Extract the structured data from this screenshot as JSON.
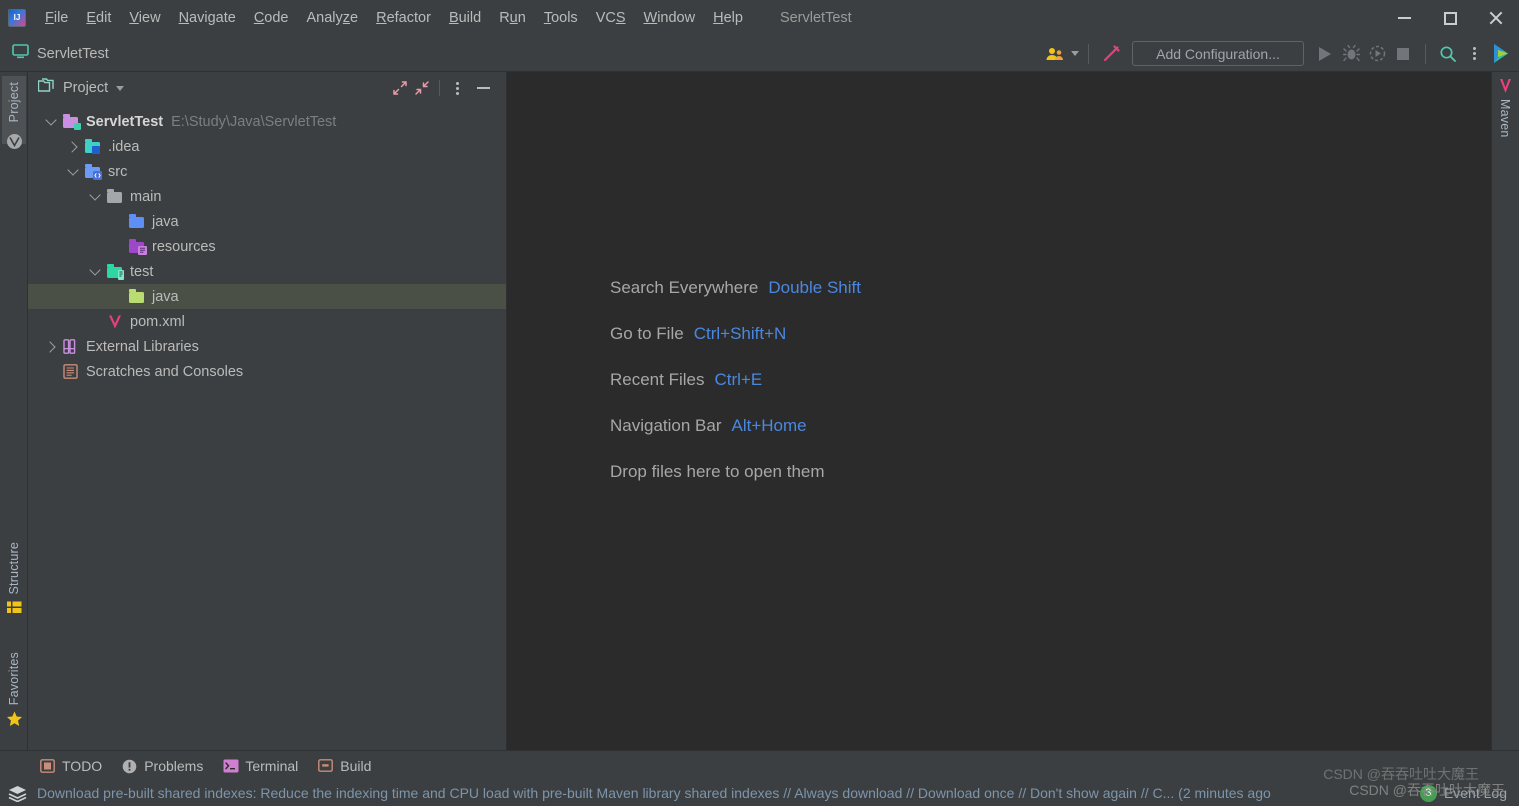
{
  "window": {
    "title": "ServletTest",
    "app_icon": "intellij-idea-logo",
    "minimize": "minimize-window",
    "maximize": "maximize-window",
    "close": "close-window"
  },
  "menubar": {
    "items": [
      {
        "label": "File",
        "mnemonic": "F"
      },
      {
        "label": "Edit",
        "mnemonic": "E"
      },
      {
        "label": "View",
        "mnemonic": "V"
      },
      {
        "label": "Navigate",
        "mnemonic": "N"
      },
      {
        "label": "Code",
        "mnemonic": "C"
      },
      {
        "label": "Analyze",
        "mnemonic": "z"
      },
      {
        "label": "Refactor",
        "mnemonic": "R"
      },
      {
        "label": "Build",
        "mnemonic": "B"
      },
      {
        "label": "Run",
        "mnemonic": "u"
      },
      {
        "label": "Tools",
        "mnemonic": "T"
      },
      {
        "label": "VCS",
        "mnemonic": "S"
      },
      {
        "label": "Window",
        "mnemonic": "W"
      },
      {
        "label": "Help",
        "mnemonic": "H"
      }
    ]
  },
  "navbar": {
    "crumb": "ServletTest",
    "crumb_icon": "project-screen-icon",
    "toolbar": {
      "code_with_me": "code-with-me-icon",
      "code_with_me_caret": "chevron-down-icon",
      "build_icon": "maven-build-hammer-icon",
      "run_config_label": "Add Configuration...",
      "run_icon": "run-icon",
      "debug_icon": "debug-bug-icon",
      "coverage_icon": "run-with-coverage-icon",
      "stop_icon": "stop-icon",
      "search_icon": "search-icon",
      "more_icon": "more-options-icon",
      "ide_icon": "ide-update-icon"
    }
  },
  "left_stripe": {
    "buttons": [
      {
        "label": "Project",
        "icon": "project-icon",
        "active": true
      },
      {
        "label": "",
        "icon": "maven-circle-icon",
        "active": false
      }
    ],
    "bottom_buttons": [
      {
        "label": "Structure",
        "icon": "structure-icon"
      },
      {
        "label": "Favorites",
        "icon": "favorites-star-icon"
      }
    ]
  },
  "right_stripe": {
    "buttons": [
      {
        "label": "Maven",
        "icon": "maven-icon"
      }
    ]
  },
  "project_panel": {
    "title": "Project",
    "title_icon": "project-folder-icon",
    "title_caret": "chevron-down-icon",
    "tools": {
      "expand_all": "expand-all-icon",
      "collapse_all": "collapse-all-icon",
      "options": "panel-options-icon",
      "hide": "hide-panel-icon"
    },
    "tree": [
      {
        "label": "ServletTest",
        "path": "E:\\Study\\Java\\ServletTest",
        "indent": 0,
        "twisty": "down",
        "icon": "module-folder-icon",
        "bold": true,
        "selected": false
      },
      {
        "label": ".idea",
        "path": "",
        "indent": 1,
        "twisty": "right",
        "icon": "idea-folder-icon",
        "bold": false,
        "selected": false
      },
      {
        "label": "src",
        "path": "",
        "indent": 1,
        "twisty": "down",
        "icon": "source-folder-icon",
        "bold": false,
        "selected": false
      },
      {
        "label": "main",
        "path": "",
        "indent": 2,
        "twisty": "down",
        "icon": "plain-folder-icon",
        "bold": false,
        "selected": false
      },
      {
        "label": "java",
        "path": "",
        "indent": 3,
        "twisty": "none",
        "icon": "sources-root-folder-icon",
        "bold": false,
        "selected": false
      },
      {
        "label": "resources",
        "path": "",
        "indent": 3,
        "twisty": "none",
        "icon": "resources-root-folder-icon",
        "bold": false,
        "selected": false
      },
      {
        "label": "test",
        "path": "",
        "indent": 2,
        "twisty": "down",
        "icon": "test-folder-icon",
        "bold": false,
        "selected": false
      },
      {
        "label": "java",
        "path": "",
        "indent": 3,
        "twisty": "none",
        "icon": "test-sources-root-folder-icon",
        "bold": false,
        "selected": true
      },
      {
        "label": "pom.xml",
        "path": "",
        "indent": 2,
        "twisty": "none",
        "icon": "maven-pom-icon",
        "bold": false,
        "selected": false
      },
      {
        "label": "External Libraries",
        "path": "",
        "indent": 0,
        "twisty": "right",
        "icon": "library-icon",
        "bold": false,
        "selected": false
      },
      {
        "label": "Scratches and Consoles",
        "path": "",
        "indent": 0,
        "twisty": "none",
        "icon": "scratches-icon",
        "bold": false,
        "selected": false
      }
    ]
  },
  "editor": {
    "hints": [
      {
        "action": "Search Everywhere",
        "key": "Double Shift"
      },
      {
        "action": "Go to File",
        "key": "Ctrl+Shift+N"
      },
      {
        "action": "Recent Files",
        "key": "Ctrl+E"
      },
      {
        "action": "Navigation Bar",
        "key": "Alt+Home"
      },
      {
        "action": "Drop files here to open them",
        "key": ""
      }
    ]
  },
  "bottom_stripe": {
    "items": [
      {
        "label": "TODO",
        "icon": "todo-icon"
      },
      {
        "label": "Problems",
        "icon": "problems-icon"
      },
      {
        "label": "Terminal",
        "icon": "terminal-icon"
      },
      {
        "label": "Build",
        "icon": "build-icon"
      }
    ]
  },
  "statusbar": {
    "icon": "shared-indexes-icon",
    "message": "Download pre-built shared indexes: Reduce the indexing time and CPU load with pre-built Maven library shared indexes // Always download // Download once // Don't show again // C... (2 minutes ago",
    "event_log_count": "3",
    "event_log_label": "Event Log"
  },
  "watermarks": {
    "primary": "CSDN @吞吞吐吐大魔王",
    "secondary": "CSDN @吞吞吐吐大魔王"
  },
  "colors": {
    "panel_bg": "#3c3f41",
    "editor_bg": "#2b2b2b",
    "selection": "#4b5047",
    "accent_blue": "#4a88df",
    "maven_pink": "#e8417a",
    "status_text": "#7d94ab",
    "badge_green": "#499c54"
  }
}
